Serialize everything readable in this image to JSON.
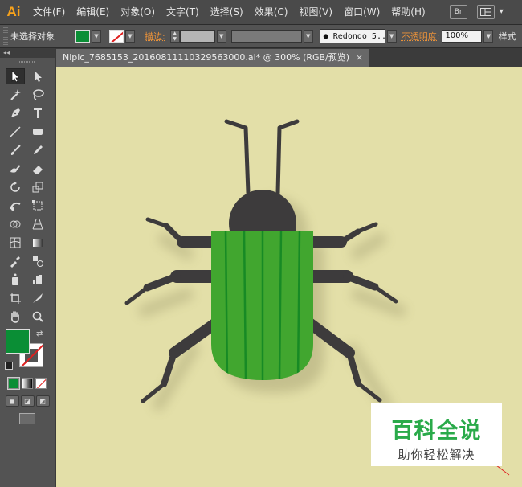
{
  "app": {
    "logo": "Ai"
  },
  "menu": {
    "items": [
      "文件(F)",
      "编辑(E)",
      "对象(O)",
      "文字(T)",
      "选择(S)",
      "效果(C)",
      "视图(V)",
      "窗口(W)",
      "帮助(H)"
    ],
    "bridge_icon": "Br",
    "arrange_icon": "▾"
  },
  "control_bar": {
    "selection_status": "未选择对象",
    "fill_color": "#0a8e35",
    "stroke_label": "描边:",
    "brush_name": "● Redondo 5...",
    "opacity_label": "不透明度:",
    "opacity_value": "100%",
    "style_label": "样式"
  },
  "document": {
    "tab_title": "Nipic_7685153_20160811110329563000.ai* @ 300% (RGB/预览)",
    "close_glyph": "×"
  },
  "toolbar": {
    "collapse_glyph": "◂◂",
    "tools": [
      "selection-tool",
      "direct-selection-tool",
      "magic-wand-tool",
      "lasso-tool",
      "pen-tool",
      "type-tool",
      "line-tool",
      "rectangle-tool",
      "paintbrush-tool",
      "pencil-tool",
      "blob-brush-tool",
      "eraser-tool",
      "rotate-tool",
      "scale-tool",
      "warp-tool",
      "free-transform-tool",
      "shape-builder-tool",
      "perspective-grid-tool",
      "mesh-tool",
      "gradient-tool",
      "eyedropper-tool",
      "blend-tool",
      "symbol-sprayer-tool",
      "column-graph-tool",
      "artboard-tool",
      "slice-tool",
      "hand-tool",
      "zoom-tool"
    ],
    "fill_color": "#0a8e35"
  },
  "canvas": {
    "background": "#e3dfa8",
    "beetle_body_color": "#3d3b3c",
    "beetle_wing_color": "#41a62f",
    "beetle_stripe_color": "#178a25"
  },
  "watermark": {
    "title": "百科全说",
    "subtitle": "助你轻松解决"
  }
}
